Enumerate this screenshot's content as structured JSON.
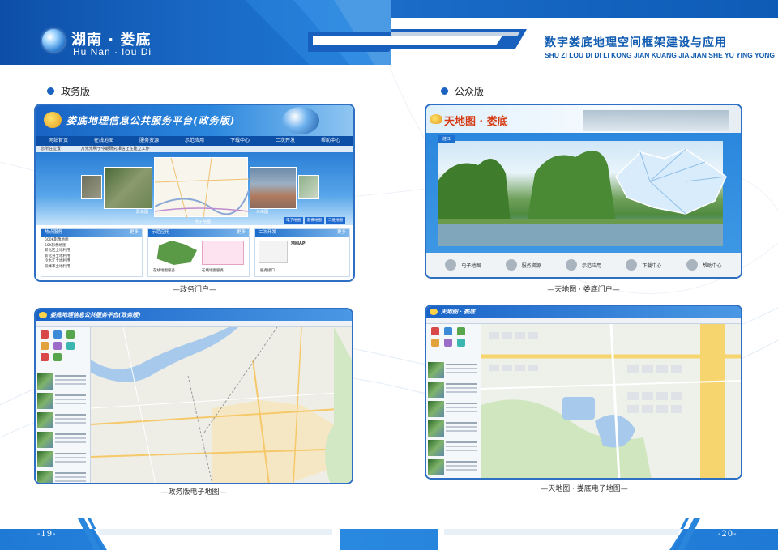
{
  "header": {
    "city_cn": "湖南 · 娄底",
    "city_en": "Hu Nan · lou Di",
    "title_cn": "数字娄底地理空间框架建设与应用",
    "title_en": "SHU ZI LOU DI DI LI KONG JIAN KUANG JIA JIAN SHE YU YING YONG"
  },
  "sections": {
    "left_label": "政务版",
    "right_label": "公众版"
  },
  "portal": {
    "title": "娄底地理信息公共服务平台(政务版)",
    "nav": [
      "网站首页",
      "在线地图",
      "服务资源",
      "示范应用",
      "下载中心",
      "二次开发",
      "帮助中心"
    ],
    "crumb": "您所在位置：",
    "crumb_notice": "万光光明于今期研究相信正在建立工作",
    "thumb_labels": [
      "影像图",
      "电子地图",
      "三维图"
    ],
    "thumb_buttons": [
      "电子地图",
      "影像地图",
      "三维地图"
    ],
    "col1_title": "热点服务",
    "col1_items": [
      "500K影像地图",
      "50K影像地图",
      "新化区土地利用",
      "新化县土地利用",
      "冷水江土地利用",
      "双峰市土地利用"
    ],
    "col2_title": "示范应用",
    "col2_cap1": "在线地图服务",
    "col2_cap2": "在线地图服务",
    "col3_title": "二次开发",
    "col3_text": "地图API",
    "col3_footer": "服务接口",
    "more": "更多"
  },
  "public_portal": {
    "logo": "天地图 · 娄底",
    "tag": "涟江",
    "buttons": [
      "电子地图",
      "服务资源",
      "示范应用",
      "下载中心",
      "帮助中心"
    ]
  },
  "captions": {
    "top_left": "—政务门户—",
    "top_right": "—天地图 · 娄底门户—",
    "bottom_left": "—政务版电子地图—",
    "bottom_right": "—天地图 · 娄底电子地图—"
  },
  "maps": {
    "left_title": "娄底地理信息公共服务平台(政务版)",
    "right_title": "天地图 · 娄底"
  },
  "footer": {
    "page_left": "-19-",
    "page_right": "-20-"
  },
  "colors": {
    "brand_blue": "#1a63c0",
    "header_dark": "#0d4fa8",
    "title_blue": "#0e5ab0"
  }
}
